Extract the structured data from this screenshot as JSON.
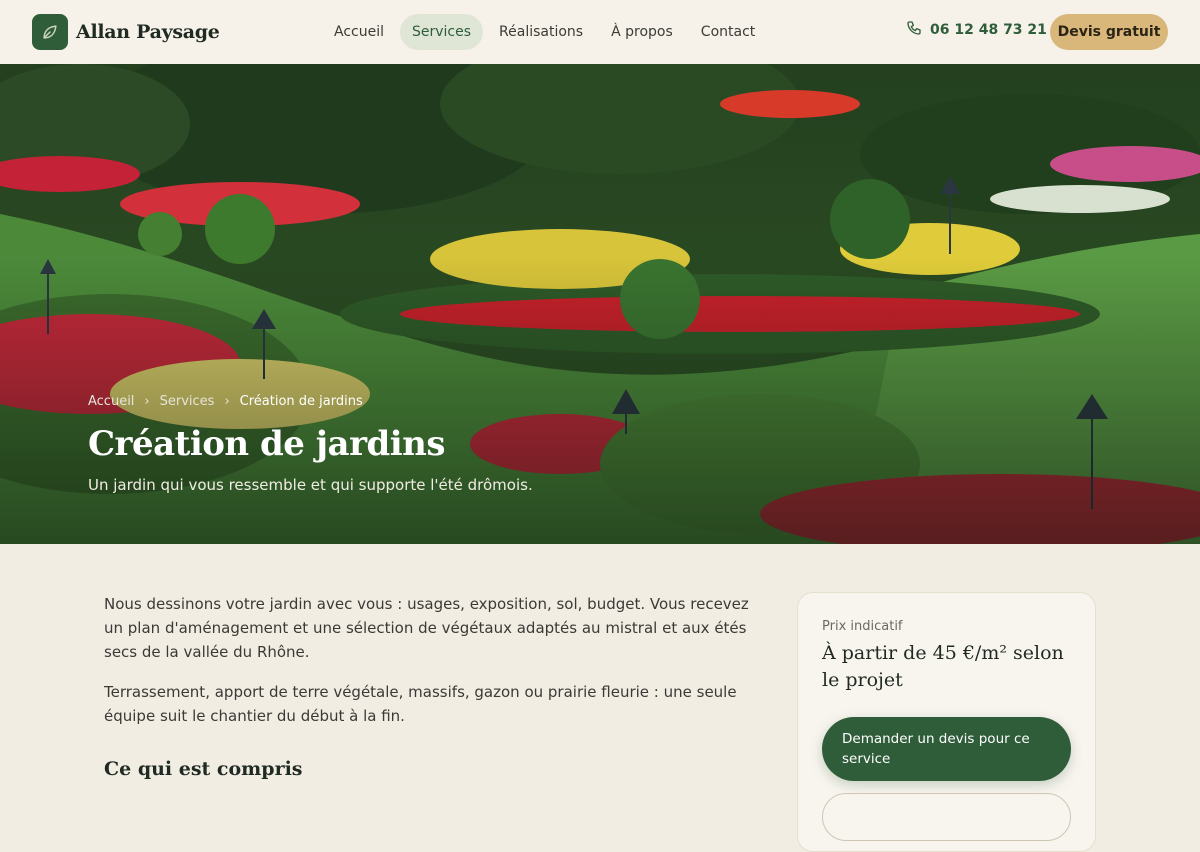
{
  "brand": {
    "name": "Allan Paysage",
    "logo_icon": "leaf-icon"
  },
  "nav": {
    "items": [
      {
        "label": "Accueil",
        "active": false
      },
      {
        "label": "Services",
        "active": true
      },
      {
        "label": "Réalisations",
        "active": false
      },
      {
        "label": "À propos",
        "active": false
      },
      {
        "label": "Contact",
        "active": false
      }
    ]
  },
  "header": {
    "phone": "06 12 48 73 21",
    "phone_icon": "phone-icon",
    "cta": "Devis gratuit"
  },
  "hero": {
    "breadcrumb": [
      "Accueil",
      "Services",
      "Création de jardins"
    ],
    "title": "Création de jardins",
    "subtitle": "Un jardin qui vous ressemble et qui supporte l'été drômois."
  },
  "content": {
    "paragraphs": [
      "Nous dessinons votre jardin avec vous : usages, exposition, sol, budget. Vous recevez un plan d'aménagement et une sélection de végétaux adaptés au mistral et aux étés secs de la vallée du Rhône.",
      "Terrassement, apport de terre végétale, massifs, gazon ou prairie fleurie : une seule équipe suit le chantier du début à la fin."
    ],
    "included_title": "Ce qui est compris"
  },
  "price_card": {
    "label": "Prix indicatif",
    "value": "À partir de 45 €/m² selon le projet",
    "button": "Demander un devis pour ce service"
  },
  "colors": {
    "primary": "#2f5d3a",
    "accent": "#d9b67a",
    "background": "#f2ede3",
    "active_pill": "#dfe6d6"
  }
}
